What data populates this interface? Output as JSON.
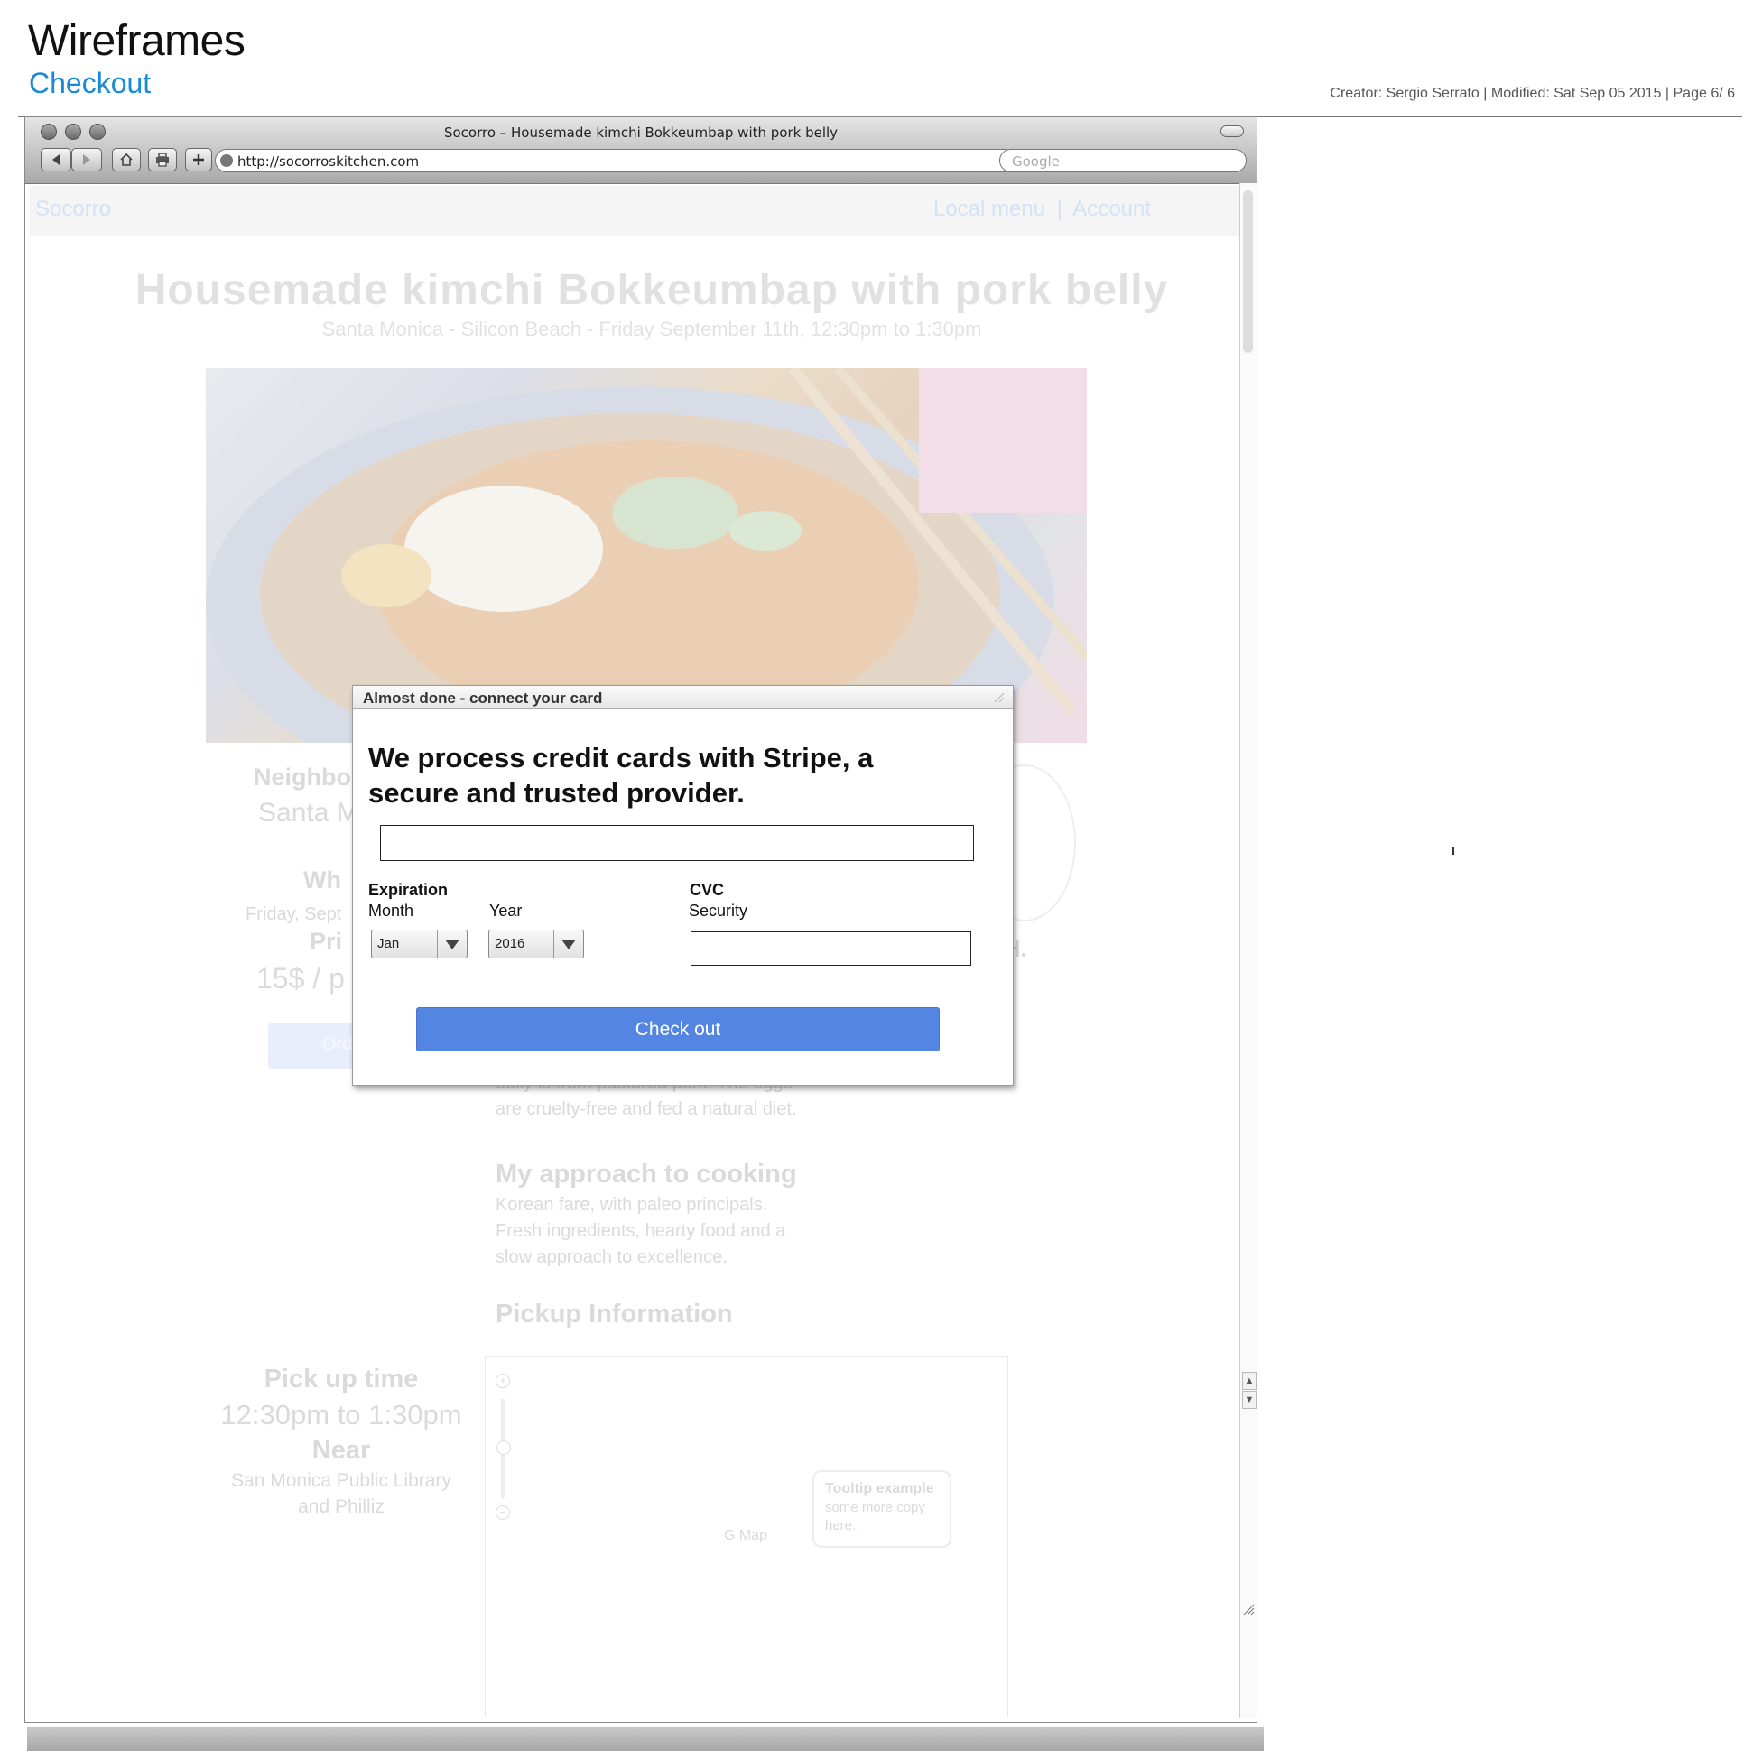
{
  "document": {
    "title": "Wireframes",
    "subtitle": "Checkout",
    "meta": "Creator: Sergio Serrato  |  Modified: Sat Sep 05 2015  |  Page 6/ 6"
  },
  "browser": {
    "window_title": "Socorro – Housemade kimchi Bokkeumbap with pork belly",
    "url": "http://socorroskitchen.com",
    "search_placeholder": "Google",
    "toolbar_icons": [
      "back-icon",
      "forward-icon",
      "home-icon",
      "print-icon",
      "add-icon",
      "globe-icon"
    ]
  },
  "site": {
    "brand": "Socorro",
    "nav_link_1": "Local menu",
    "nav_separator": "|",
    "nav_link_2": "Account",
    "hero_title": "Housemade kimchi Bokkeumbap with pork belly",
    "hero_subtitle": "Santa Monica - Silicon Beach - Friday September 11th, 12:30pm to 1:30pm",
    "neighborhood_label": "Neighbo",
    "neighborhood_value": "Santa M",
    "when_label": "Wh",
    "when_value": "Friday, Sept",
    "price_label": "Pri",
    "price_value": "15$ / p",
    "order_button_label": "Ord",
    "chef_initial": "H.",
    "description_tail_1": "belly is from pastured pork. The eggs",
    "description_tail_2": "are cruelty-free and fed a natural diet.",
    "approach_heading": "My approach to cooking",
    "approach_line_1": "Korean fare, with paleo principals.",
    "approach_line_2": "Fresh ingredients, hearty food and a",
    "approach_line_3": "slow approach to excellence.",
    "pickup_heading": "Pickup Information",
    "pickup_time_label": "Pick up time",
    "pickup_time_value": "12:30pm to 1:30pm",
    "near_label": "Near",
    "near_value_1": "San Monica Public Library",
    "near_value_2": "and Philliz",
    "map_label": "G Map",
    "tooltip_title": "Tooltip example",
    "tooltip_line_1": "some more copy",
    "tooltip_line_2": "here.."
  },
  "modal": {
    "title": "Almost done - connect your card",
    "heading": "We process credit cards with Stripe, a secure and trusted provider.",
    "card_number_value": "",
    "expiration_label": "Expiration",
    "month_label": "Month",
    "year_label": "Year",
    "month_value": "Jan",
    "year_value": "2016",
    "cvc_label": "CVC",
    "security_label": "Security",
    "cvc_value": "",
    "checkout_label": "Check out"
  },
  "colors": {
    "accent_link": "#1a8ad8",
    "checkout_button": "#5585e3"
  }
}
